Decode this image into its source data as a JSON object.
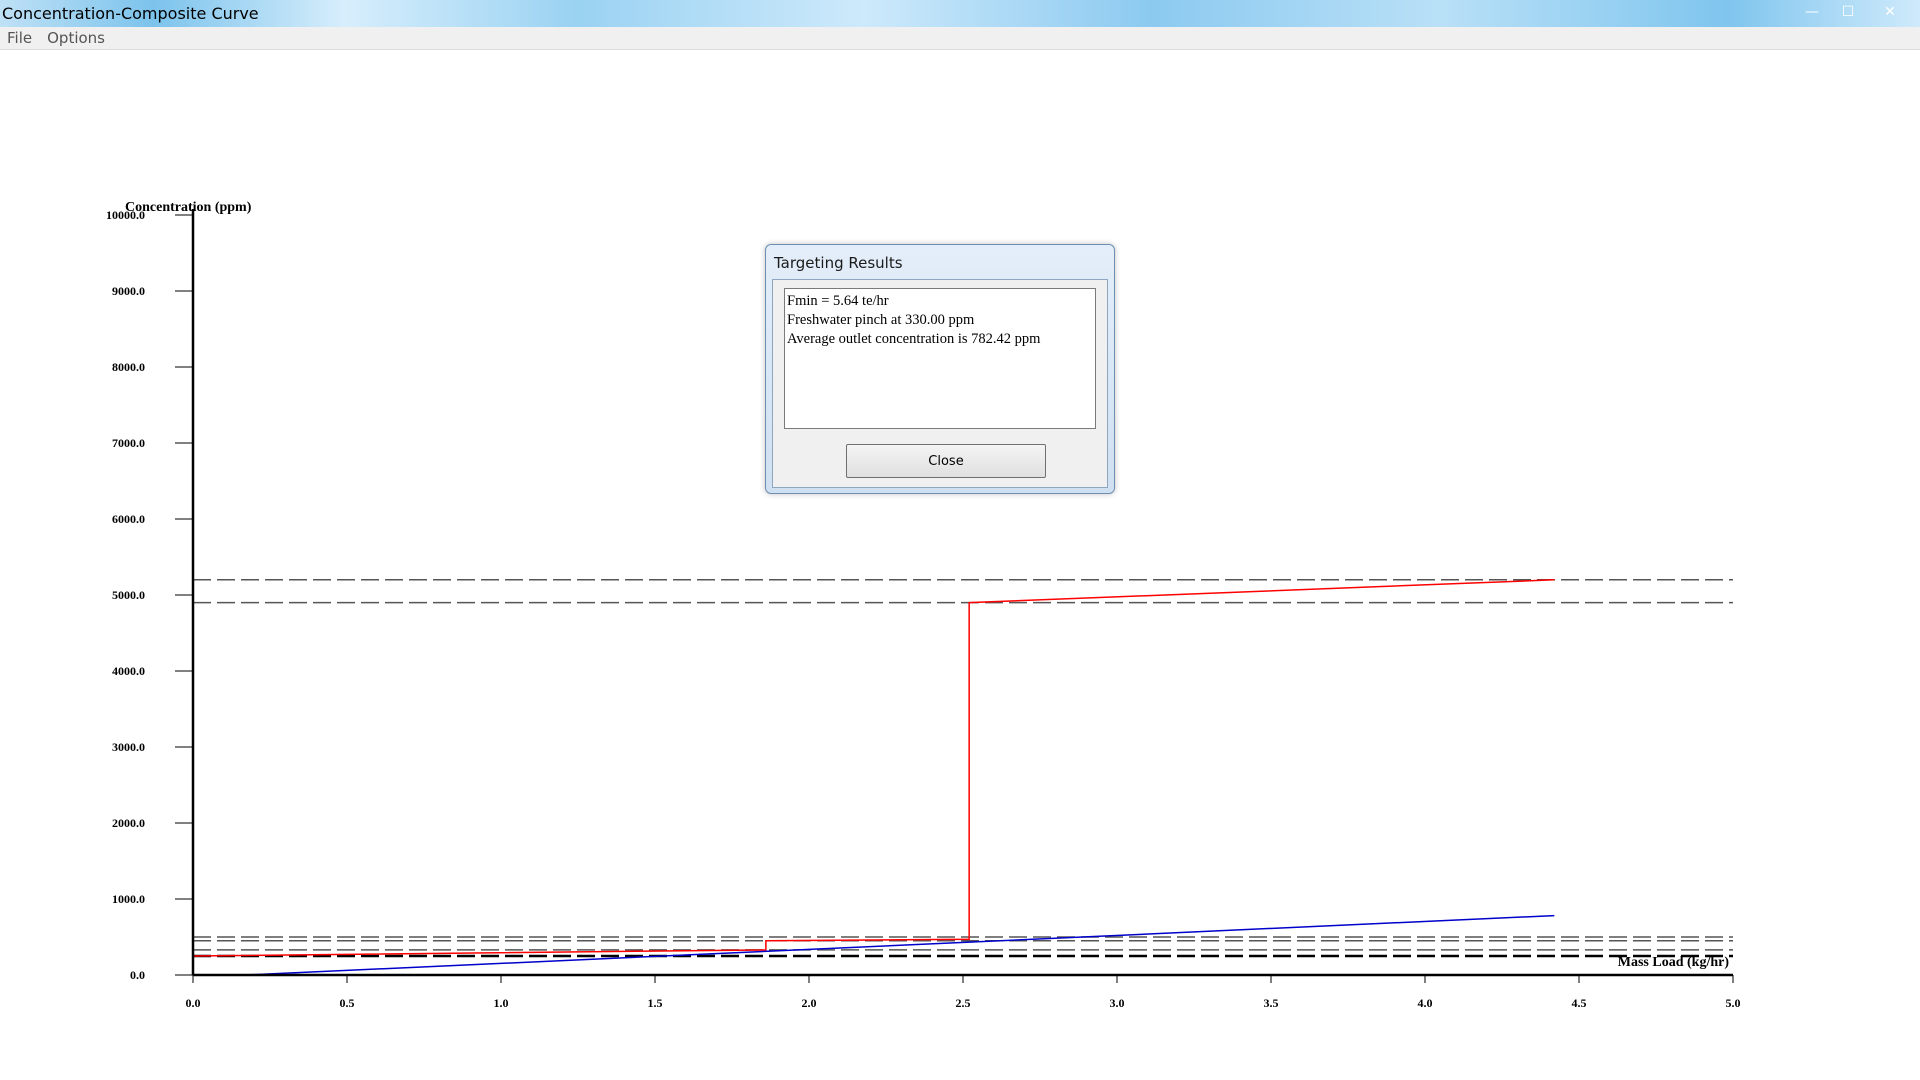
{
  "window": {
    "title": "Concentration-Composite Curve",
    "controls": {
      "minimize": "—",
      "maximize": "☐",
      "close": "✕"
    }
  },
  "menu": {
    "items": [
      "File",
      "Options"
    ]
  },
  "dialog": {
    "title": "Targeting Results",
    "lines": [
      "Fmin = 5.64 te/hr",
      "Freshwater pinch at 330.00 ppm",
      "Average outlet concentration is 782.42 ppm"
    ],
    "close_label": "Close"
  },
  "chart_data": {
    "type": "line",
    "title": "",
    "xlabel": "Mass Load (kg/hr)",
    "ylabel": "Concentration (ppm)",
    "xlim": [
      0,
      5
    ],
    "ylim": [
      0,
      10000
    ],
    "x_ticks": [
      0.0,
      0.5,
      1.0,
      1.5,
      2.0,
      2.5,
      3.0,
      3.5,
      4.0,
      4.5,
      5.0
    ],
    "y_ticks": [
      0,
      1000,
      2000,
      3000,
      4000,
      5000,
      6000,
      7000,
      8000,
      9000,
      10000
    ],
    "y_tick_decimals": 1,
    "grid": false,
    "series": [
      {
        "color": "#ff0000",
        "x": [
          0.0,
          1.86,
          1.86,
          2.52,
          2.52,
          4.42
        ],
        "y": [
          250,
          330,
          450,
          470,
          4900,
          5200
        ]
      },
      {
        "color": "#0000cc",
        "x": [
          0.17,
          4.42
        ],
        "y": [
          0,
          782
        ]
      }
    ],
    "reference_lines": [
      {
        "y": 5200,
        "color": "#555555",
        "width": 1.5
      },
      {
        "y": 4900,
        "color": "#555555",
        "width": 1.5
      },
      {
        "y": 500,
        "color": "#555555",
        "width": 1.5
      },
      {
        "y": 450,
        "color": "#555555",
        "width": 1.5
      },
      {
        "y": 330,
        "color": "#555555",
        "width": 1.5
      },
      {
        "y": 250,
        "color": "#000000",
        "width": 2.5
      }
    ]
  }
}
